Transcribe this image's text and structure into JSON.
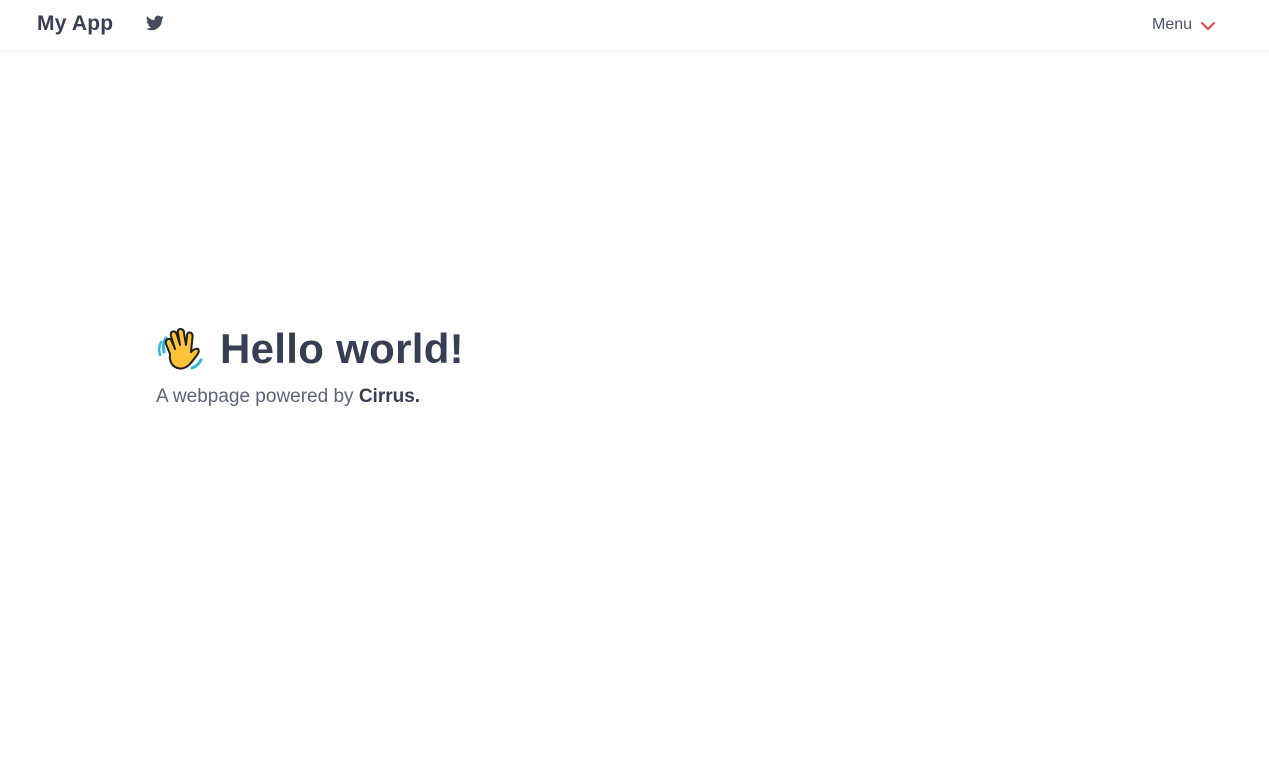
{
  "header": {
    "brand": "My App",
    "menu_label": "Menu"
  },
  "icons": {
    "twitter": "twitter-icon",
    "menu_chevron": "chevron-down-icon",
    "wave": "waving-hand-icon"
  },
  "hero": {
    "title": "Hello world!",
    "subtitle_prefix": "A webpage powered by ",
    "subtitle_brand": "Cirrus."
  },
  "colors": {
    "text": "#374054",
    "accent": "#e74b5a",
    "background": "#ffffff"
  }
}
